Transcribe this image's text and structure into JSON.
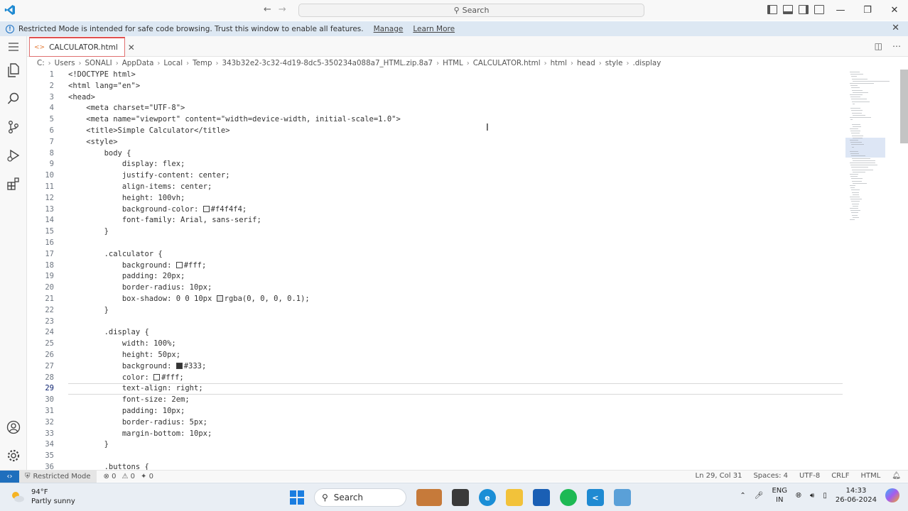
{
  "titlebar": {
    "search_placeholder": "Search",
    "window_controls": [
      "minimize",
      "restore",
      "close"
    ]
  },
  "banner": {
    "message": "Restricted Mode is intended for safe code browsing. Trust this window to enable all features.",
    "manage_label": "Manage",
    "learn_more_label": "Learn More"
  },
  "tab": {
    "filename": "CALCULATOR.html"
  },
  "breadcrumb": [
    "C:",
    "Users",
    "SONALI",
    "AppData",
    "Local",
    "Temp",
    "343b32e2-3c32-4d19-8dc5-350234a088a7_HTML.zip.8a7",
    "HTML",
    "CALCULATOR.html",
    "html",
    "head",
    "style",
    ".display"
  ],
  "editor": {
    "current_line": 29,
    "lines": [
      {
        "n": 1,
        "text": "<!DOCTYPE html>"
      },
      {
        "n": 2,
        "text": "<html lang=\"en\">"
      },
      {
        "n": 3,
        "text": "<head>"
      },
      {
        "n": 4,
        "text": "    <meta charset=\"UTF-8\">"
      },
      {
        "n": 5,
        "text": "    <meta name=\"viewport\" content=\"width=device-width, initial-scale=1.0\">"
      },
      {
        "n": 6,
        "text": "    <title>Simple Calculator</title>"
      },
      {
        "n": 7,
        "text": "    <style>"
      },
      {
        "n": 8,
        "text": "        body {"
      },
      {
        "n": 9,
        "text": "            display: flex;"
      },
      {
        "n": 10,
        "text": "            justify-content: center;"
      },
      {
        "n": 11,
        "text": "            align-items: center;"
      },
      {
        "n": 12,
        "text": "            height: 100vh;"
      },
      {
        "n": 13,
        "text": "            background-color: ",
        "swatch": "#f4f4f4",
        "after": "#f4f4f4;"
      },
      {
        "n": 14,
        "text": "            font-family: Arial, sans-serif;"
      },
      {
        "n": 15,
        "text": "        }"
      },
      {
        "n": 16,
        "text": ""
      },
      {
        "n": 17,
        "text": "        .calculator {"
      },
      {
        "n": 18,
        "text": "            background: ",
        "swatch": "#ffffff",
        "after": "#fff;"
      },
      {
        "n": 19,
        "text": "            padding: 20px;"
      },
      {
        "n": 20,
        "text": "            border-radius: 10px;"
      },
      {
        "n": 21,
        "text": "            box-shadow: 0 0 10px ",
        "swatch": "#e6e6e6",
        "after": "rgba(0, 0, 0, 0.1);"
      },
      {
        "n": 22,
        "text": "        }"
      },
      {
        "n": 23,
        "text": ""
      },
      {
        "n": 24,
        "text": "        .display {"
      },
      {
        "n": 25,
        "text": "            width: 100%;"
      },
      {
        "n": 26,
        "text": "            height: 50px;"
      },
      {
        "n": 27,
        "text": "            background: ",
        "swatch": "#333333",
        "after": "#333;"
      },
      {
        "n": 28,
        "text": "            color: ",
        "swatch": "#ffffff",
        "after": "#fff;"
      },
      {
        "n": 29,
        "text": "            text-align: right;"
      },
      {
        "n": 30,
        "text": "            font-size: 2em;"
      },
      {
        "n": 31,
        "text": "            padding: 10px;"
      },
      {
        "n": 32,
        "text": "            border-radius: 5px;"
      },
      {
        "n": 33,
        "text": "            margin-bottom: 10px;"
      },
      {
        "n": 34,
        "text": "        }"
      },
      {
        "n": 35,
        "text": ""
      },
      {
        "n": 36,
        "text": "        .buttons {"
      }
    ]
  },
  "statusbar": {
    "restricted_label": "Restricted Mode",
    "errors": "0",
    "warnings": "0",
    "info": "0",
    "position": "Ln 29, Col 31",
    "spaces": "Spaces: 4",
    "encoding": "UTF-8",
    "eol": "CRLF",
    "language": "HTML"
  },
  "taskbar": {
    "weather_temp": "94°F",
    "weather_desc": "Partly sunny",
    "search_label": "Search",
    "lang_top": "ENG",
    "lang_bottom": "IN",
    "time": "14:33",
    "date": "26-06-2024"
  },
  "colors": {
    "accent": "#1f6fbd",
    "tab_border": "#e05050",
    "banner_bg": "#dde8f3"
  }
}
